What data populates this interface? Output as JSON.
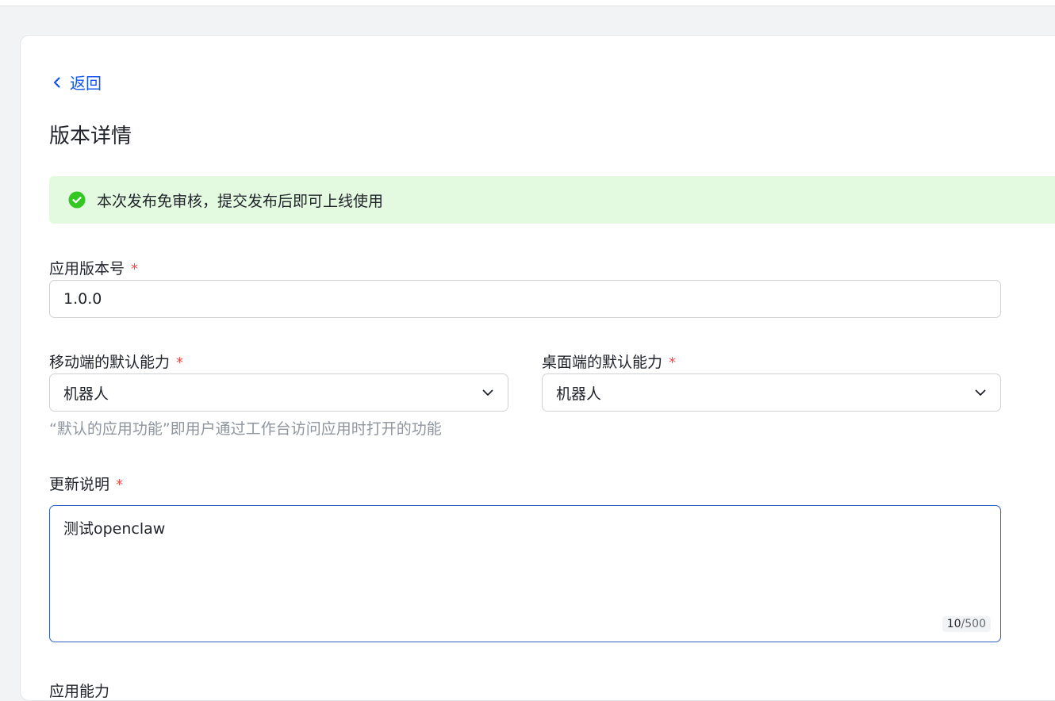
{
  "nav": {
    "back_label": "返回"
  },
  "page": {
    "title": "版本详情"
  },
  "notice": {
    "text": "本次发布免审核，提交发布后即可上线使用"
  },
  "form": {
    "version": {
      "label": "应用版本号",
      "required_mark": "*",
      "value": "1.0.0"
    },
    "mobile_default": {
      "label": "移动端的默认能力",
      "required_mark": "*",
      "value": "机器人"
    },
    "desktop_default": {
      "label": "桌面端的默认能力",
      "required_mark": "*",
      "value": "机器人"
    },
    "default_hint": "“默认的应用功能”即用户通过工作台访问应用时打开的功能",
    "release_notes": {
      "label": "更新说明",
      "required_mark": "*",
      "value": "测试openclaw",
      "count_current": "10",
      "count_max": "/500"
    },
    "next_section_label": "应用能力"
  },
  "colors": {
    "accent": "#1456f0",
    "success": "#34c724",
    "notice_bg": "#e3f9e0",
    "required": "#f54a45"
  }
}
